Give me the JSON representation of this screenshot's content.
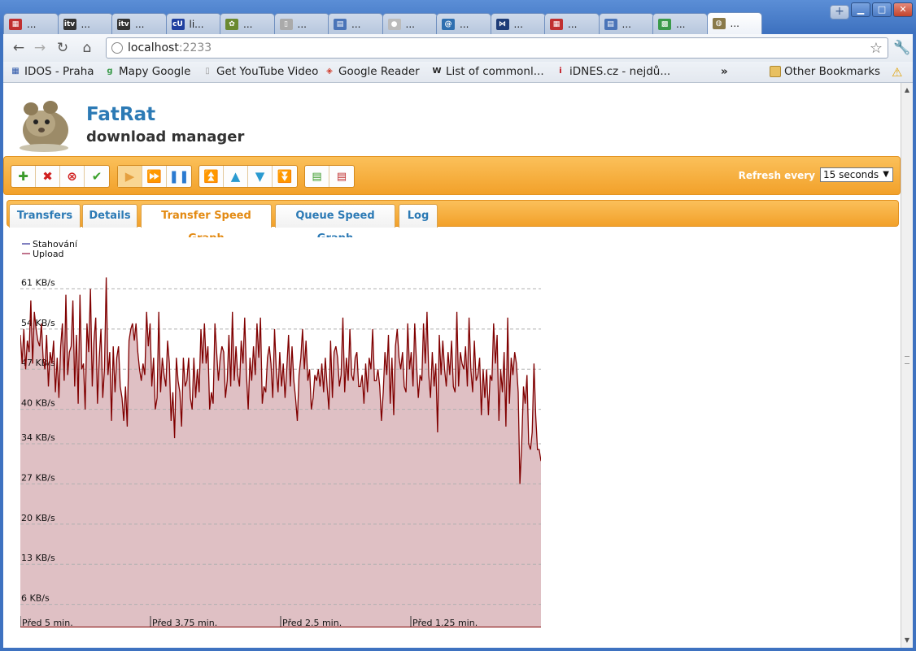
{
  "browser": {
    "tabs": [
      {
        "label": "...",
        "icon": "calendar-icon",
        "color": "#c03030"
      },
      {
        "label": "...",
        "icon": "itv-icon",
        "color": "#333333"
      },
      {
        "label": "...",
        "icon": "itv-icon",
        "color": "#333333"
      },
      {
        "label": "li...",
        "icon": "curl-icon",
        "color": "#2040a0"
      },
      {
        "label": "...",
        "icon": "globe-icon",
        "color": "#6a8a30"
      },
      {
        "label": "...",
        "icon": "page-icon",
        "color": "#aaaaaa"
      },
      {
        "label": "...",
        "icon": "doc-icon",
        "color": "#4a74b8"
      },
      {
        "label": "...",
        "icon": "circle-icon",
        "color": "#bbbbbb"
      },
      {
        "label": "...",
        "icon": "at-icon",
        "color": "#2e6fb0"
      },
      {
        "label": "...",
        "icon": "bowtie-icon",
        "color": "#1e3c78"
      },
      {
        "label": "...",
        "icon": "calendar-icon",
        "color": "#c03030"
      },
      {
        "label": "...",
        "icon": "doc-icon",
        "color": "#4a74b8"
      },
      {
        "label": "...",
        "icon": "map-icon",
        "color": "#3a9a4a"
      },
      {
        "label": "...",
        "icon": "rat-icon",
        "color": "#8a7a4a",
        "active": true
      }
    ],
    "url_host": "localhost",
    "url_port": ":2233",
    "bookmarks": [
      {
        "label": "IDOS - Praha",
        "icon": "idos-icon",
        "color": "#2a55a8"
      },
      {
        "label": "Mapy Google",
        "icon": "google-maps-icon",
        "color": "#3a9a4a"
      },
      {
        "label": "Get YouTube Video",
        "icon": "page-icon",
        "color": "#999999"
      },
      {
        "label": "Google Reader",
        "icon": "reader-icon",
        "color": "#d04030"
      },
      {
        "label": "List of commonl...",
        "icon": "wikipedia-icon",
        "color": "#222222"
      },
      {
        "label": "iDNES.cz - nejdů...",
        "icon": "idnes-icon",
        "color": "#c0101a"
      }
    ],
    "more_label": "»",
    "other_bookmarks": "Other Bookmarks"
  },
  "app": {
    "title": "FatRat",
    "subtitle": "download manager",
    "refresh_label": "Refresh every",
    "refresh_value": "15 seconds",
    "tabs": [
      "Transfers",
      "Details",
      "Transfer Speed Graph",
      "Queue Speed Graph",
      "Log"
    ],
    "active_tab": 2
  },
  "chart_data": {
    "type": "area",
    "legend": [
      {
        "name": "Stahování",
        "color": "#5555aa"
      },
      {
        "name": "Upload",
        "color": "#aa4466"
      }
    ],
    "legend_position": "top-left",
    "y_ticks": [
      "61 KB/s",
      "54 KB/s",
      "47 KB/s",
      "40 KB/s",
      "34 KB/s",
      "27 KB/s",
      "20 KB/s",
      "13 KB/s",
      "6 KB/s"
    ],
    "x_ticks": [
      "Před 5 min.",
      "Před 3.75 min.",
      "Před 2.5 min.",
      "Před 1.25 min."
    ],
    "ylim": [
      0,
      68
    ],
    "grid": true,
    "series": [
      {
        "name": "Upload",
        "color": "#800000",
        "fill": "#dfc0c4",
        "values": [
          51,
          46,
          52,
          45,
          50,
          48,
          57,
          46,
          55,
          52,
          50,
          49,
          53,
          47,
          45,
          51,
          42,
          48,
          46,
          50,
          41,
          47,
          40,
          49,
          53,
          43,
          58,
          44,
          48,
          49,
          57,
          42,
          51,
          39,
          58,
          45,
          46,
          38,
          53,
          48,
          59,
          42,
          50,
          54,
          39,
          47,
          52,
          40,
          45,
          61,
          44,
          48,
          36,
          49,
          41,
          47,
          49,
          42,
          40,
          36,
          42,
          35,
          50,
          52,
          53,
          50,
          53,
          48,
          45,
          43,
          46,
          44,
          55,
          49,
          53,
          42,
          47,
          38,
          40,
          55,
          41,
          47,
          44,
          42,
          50,
          46,
          36,
          41,
          33,
          47,
          43,
          41,
          35,
          47,
          42,
          43,
          47,
          40,
          38,
          47,
          40,
          45,
          41,
          52,
          46,
          53,
          46,
          49,
          38,
          41,
          39,
          53,
          48,
          43,
          47,
          49,
          48,
          40,
          43,
          51,
          42,
          55,
          43,
          49,
          44,
          42,
          50,
          46,
          54,
          44,
          38,
          47,
          43,
          49,
          44,
          53,
          47,
          54,
          39,
          42,
          41,
          47,
          49,
          46,
          40,
          52,
          45,
          41,
          48,
          42,
          46,
          40,
          45,
          51,
          42,
          49,
          43,
          40,
          36,
          44,
          47,
          52,
          45,
          50,
          43,
          45,
          38,
          40,
          44,
          43,
          45,
          42,
          46,
          41,
          47,
          42,
          38,
          50,
          40,
          48,
          49,
          47,
          42,
          44,
          54,
          41,
          47,
          43,
          52,
          44,
          43,
          47,
          48,
          42,
          42,
          44,
          39,
          46,
          41,
          47,
          45,
          52,
          43,
          43,
          45,
          42,
          36,
          41,
          48,
          44,
          51,
          39,
          47,
          37,
          49,
          52,
          47,
          45,
          48,
          42,
          41,
          53,
          45,
          48,
          42,
          53,
          46,
          40,
          44,
          43,
          53,
          46,
          55,
          44,
          40,
          48,
          42,
          46,
          34,
          51,
          44,
          50,
          45,
          42,
          48,
          44,
          50,
          42,
          41,
          55,
          42,
          48,
          46,
          45,
          49,
          42,
          54,
          45,
          41,
          50,
          43,
          44,
          47,
          37,
          45,
          40,
          45,
          37,
          44,
          43,
          53,
          46,
          51,
          36,
          45,
          41,
          48,
          35,
          54,
          39,
          47,
          44,
          48,
          46,
          41,
          25,
          32,
          42,
          39,
          44,
          32,
          31,
          34,
          46,
          37,
          31,
          31,
          29
        ]
      }
    ]
  }
}
